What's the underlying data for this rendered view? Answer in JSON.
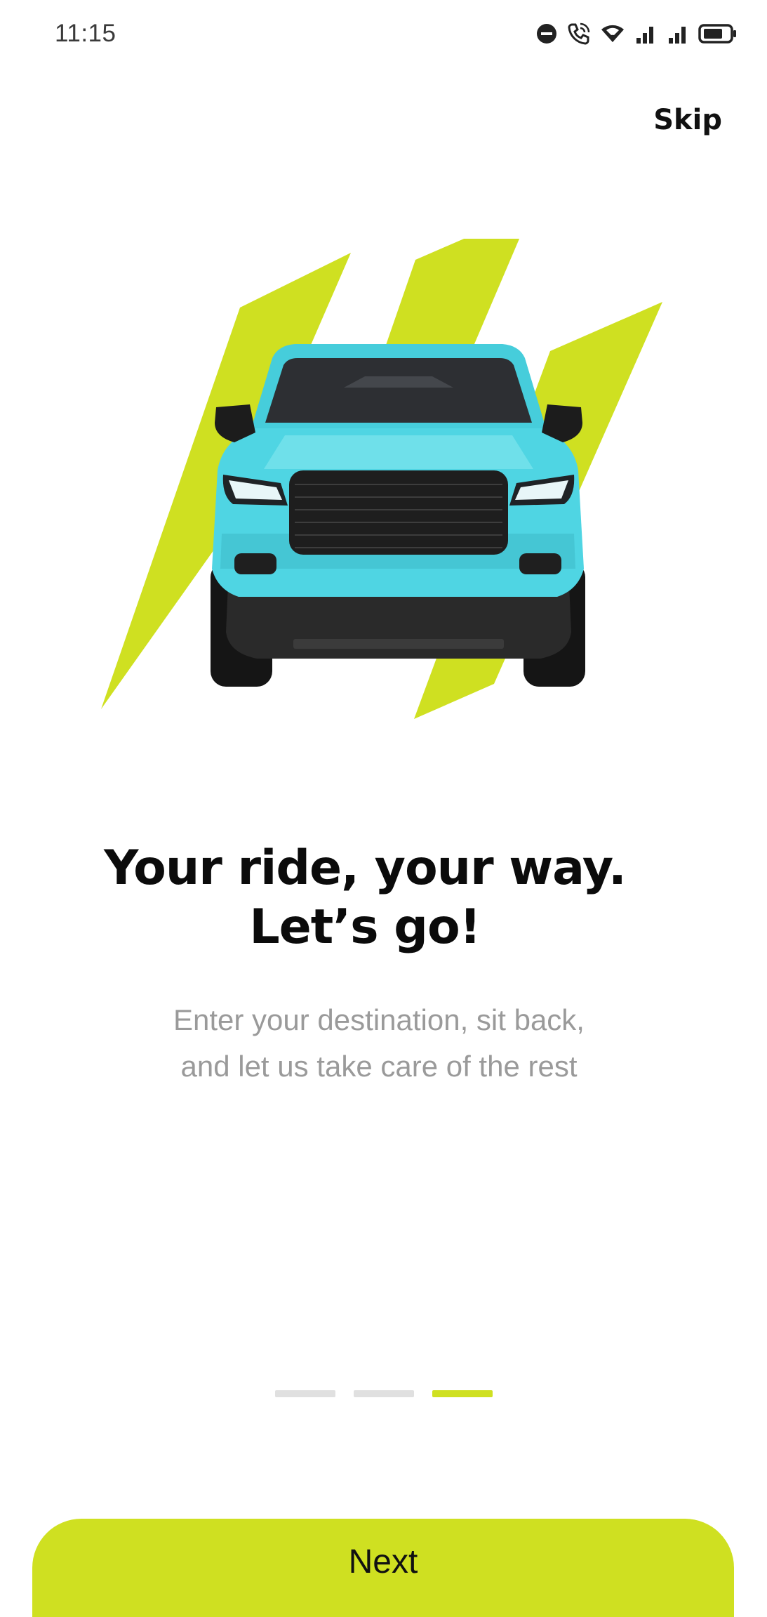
{
  "status_bar": {
    "time": "11:15",
    "icons": [
      "dnd-icon",
      "call-icon",
      "wifi-icon",
      "signal-icon",
      "signal-icon",
      "battery-icon"
    ]
  },
  "onboarding": {
    "skip_label": "Skip",
    "illustration": "car-icon",
    "headline_line1": "Your ride, your way.",
    "headline_line2": "Let’s go!",
    "subtext_line1": "Enter your destination, sit back,",
    "subtext_line2": "and let us take care of the rest",
    "page_count": 3,
    "current_page": 3,
    "next_label": "Next"
  },
  "colors": {
    "accent": "#cfe021",
    "car_body": "#4fd5e3",
    "text_primary": "#0b0b0b",
    "text_secondary": "#9a9a9a",
    "inactive_dot": "#e0e0e0"
  }
}
